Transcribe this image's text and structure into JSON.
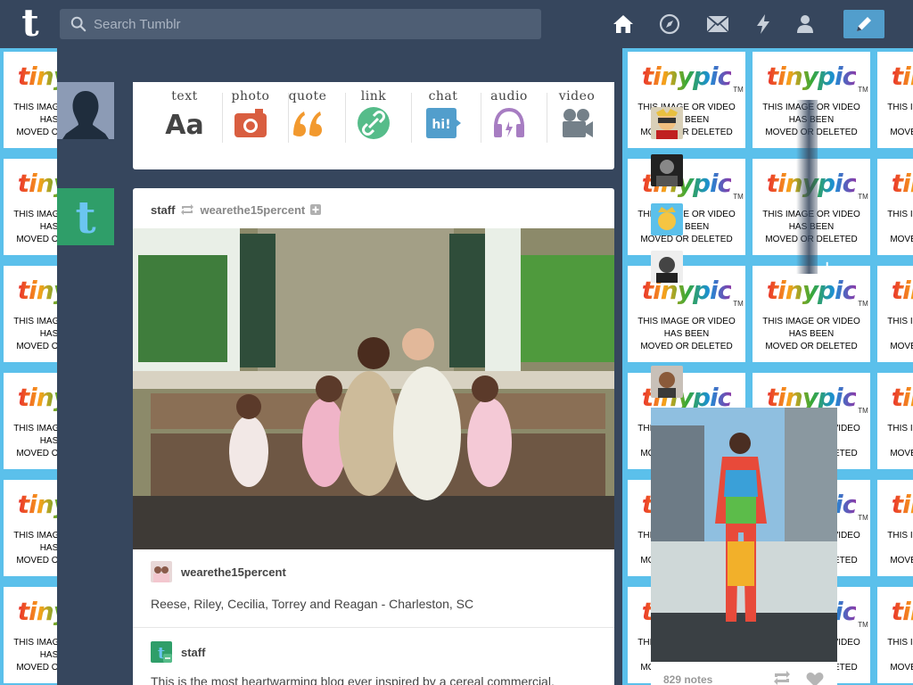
{
  "topbar": {
    "logo": "t",
    "search_placeholder": "Search Tumblr",
    "nav_icons": [
      "home-icon",
      "explore-icon",
      "inbox-icon",
      "activity-icon",
      "account-icon"
    ],
    "compose_icon": "pencil-icon",
    "colors": {
      "bar": "#36465d",
      "compose": "#529ecc"
    }
  },
  "background": {
    "tile_logo": "tinypic",
    "tile_tm": "TM",
    "tile_message_lines": [
      "THIS IMAGE OR VIDEO",
      "HAS BEEN",
      "MOVED OR DELETED"
    ]
  },
  "post_types": [
    {
      "label": "text",
      "icon": "text-icon",
      "glyph": "Aa",
      "color": "#444444"
    },
    {
      "label": "photo",
      "icon": "camera-icon",
      "color": "#d95e40"
    },
    {
      "label": "quote",
      "icon": "quote-icon",
      "glyph": "❝",
      "color": "#f2992e"
    },
    {
      "label": "link",
      "icon": "link-icon",
      "color": "#56bc8a"
    },
    {
      "label": "chat",
      "icon": "chat-icon",
      "glyph": "hi!",
      "color": "#529ecc"
    },
    {
      "label": "audio",
      "icon": "headphones-icon",
      "color": "#a77dc2"
    },
    {
      "label": "video",
      "icon": "video-camera-icon",
      "color": "#748089"
    }
  ],
  "post": {
    "author": "staff",
    "reblogged_from": "wearethe15percent",
    "source_blog": "wearethe15percent",
    "caption": "Reese, Riley, Cecilia, Torrey and Reagan - Charleston, SC",
    "reblogger": "staff",
    "reblog_text": "This is the most heartwarming blog ever inspired by a cereal commercial."
  },
  "radar": {
    "notes": "829 notes"
  }
}
